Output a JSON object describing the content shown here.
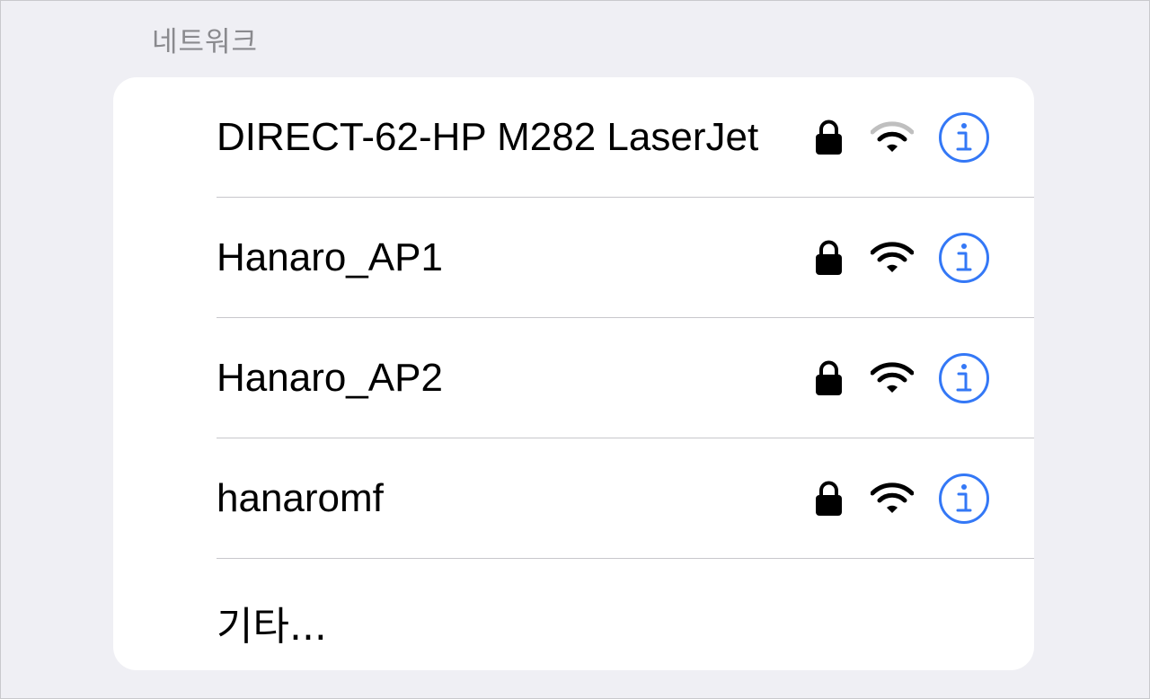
{
  "section": {
    "title": "네트워크"
  },
  "networks": [
    {
      "name": "DIRECT-62-HP M282 LaserJet",
      "secured": true,
      "signal": "weak"
    },
    {
      "name": "Hanaro_AP1",
      "secured": true,
      "signal": "full"
    },
    {
      "name": "Hanaro_AP2",
      "secured": true,
      "signal": "full"
    },
    {
      "name": "hanaromf",
      "secured": true,
      "signal": "full"
    }
  ],
  "other": {
    "label": "기타..."
  },
  "icons": {
    "lock": "lock-icon",
    "wifi": "wifi-icon",
    "info": "info-icon"
  },
  "colors": {
    "accent": "#3478f6",
    "wifi_strong": "#000000",
    "wifi_faint": "#bfbfbf",
    "background": "#efeff4"
  }
}
